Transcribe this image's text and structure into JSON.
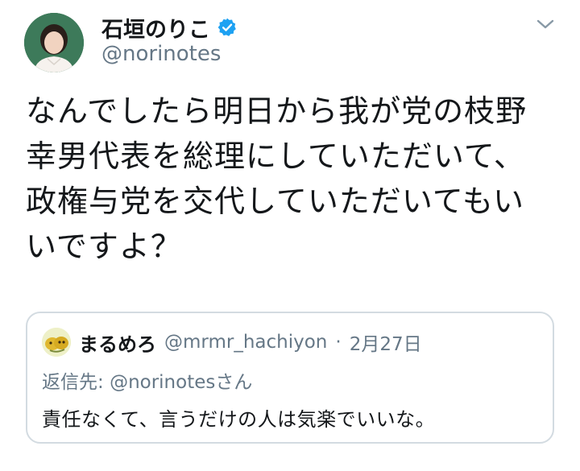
{
  "tweet": {
    "display_name": "石垣のりこ",
    "handle": "@norinotes",
    "verified": true,
    "menu_icon": "chevron-down-icon",
    "text": "なんでしたら明日から我が党の枝野幸男代表を総理にしていただいて、政権与党を交代していただいてもいいですよ？"
  },
  "quote": {
    "display_name": "まるめろ",
    "handle": "@mrmr_hachiyon",
    "separator": "·",
    "date": "2月27日",
    "reply_label": "返信先:",
    "reply_mention": "@norinotes",
    "reply_suffix": "さん",
    "text": "責任なくて、言うだけの人は気楽でいいな。"
  },
  "colors": {
    "verified": "#1da1f2",
    "secondary_text": "#657786",
    "border": "#d3dbe1"
  }
}
